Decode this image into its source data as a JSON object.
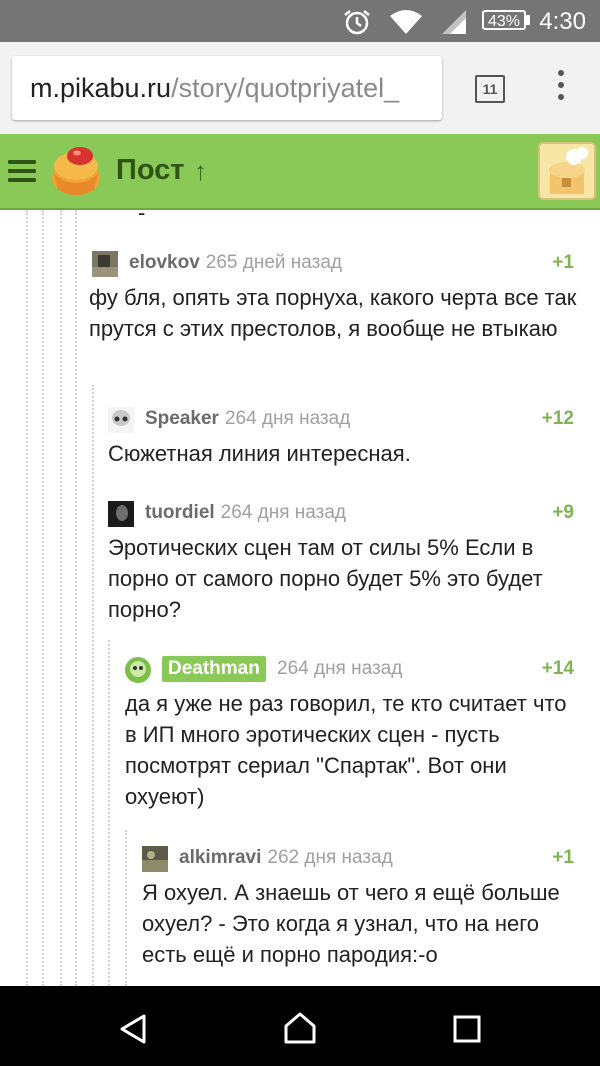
{
  "status_bar": {
    "time": "4:30",
    "battery": "43%",
    "icons": [
      "alarm-icon",
      "wifi-icon",
      "signal-icon",
      "battery-icon"
    ]
  },
  "browser": {
    "url_host": "m.pikabu.ru",
    "url_path": "/story/quotpriyatel_",
    "tabs_count": "11"
  },
  "header": {
    "title": "Пост",
    "accent": "#8ac858"
  },
  "comments": [
    {
      "author": "elovkov",
      "time": "265 дней назад",
      "rating": "+1",
      "text": "фу бля, опять эта порнуха, какого черта все так прутся с этих престолов, я вообще не втыкаю"
    },
    {
      "author": "Speaker",
      "time": "264 дня назад",
      "rating": "+12",
      "text": "Сюжетная линия интересная."
    },
    {
      "author": "tuordiel",
      "time": "264 дня назад",
      "rating": "+9",
      "text": "Эротических сцен там от силы 5% Если в порно от самого порно будет 5% это будет порно?"
    },
    {
      "author": "Deathman",
      "time": "264 дня назад",
      "rating": "+14",
      "text": "да я уже не раз говорил, те кто считает что в ИП много эротических сцен - пусть посмотрят сериал \"Спартак\". Вот они охуеют)"
    },
    {
      "author": "alkimravi",
      "time": "262 дня назад",
      "rating": "+1",
      "text": "Я охуел. А знаешь от чего я ещё больше охуел? - Это когда я узнал, что на него есть ещё и порно пародия:-о"
    }
  ]
}
